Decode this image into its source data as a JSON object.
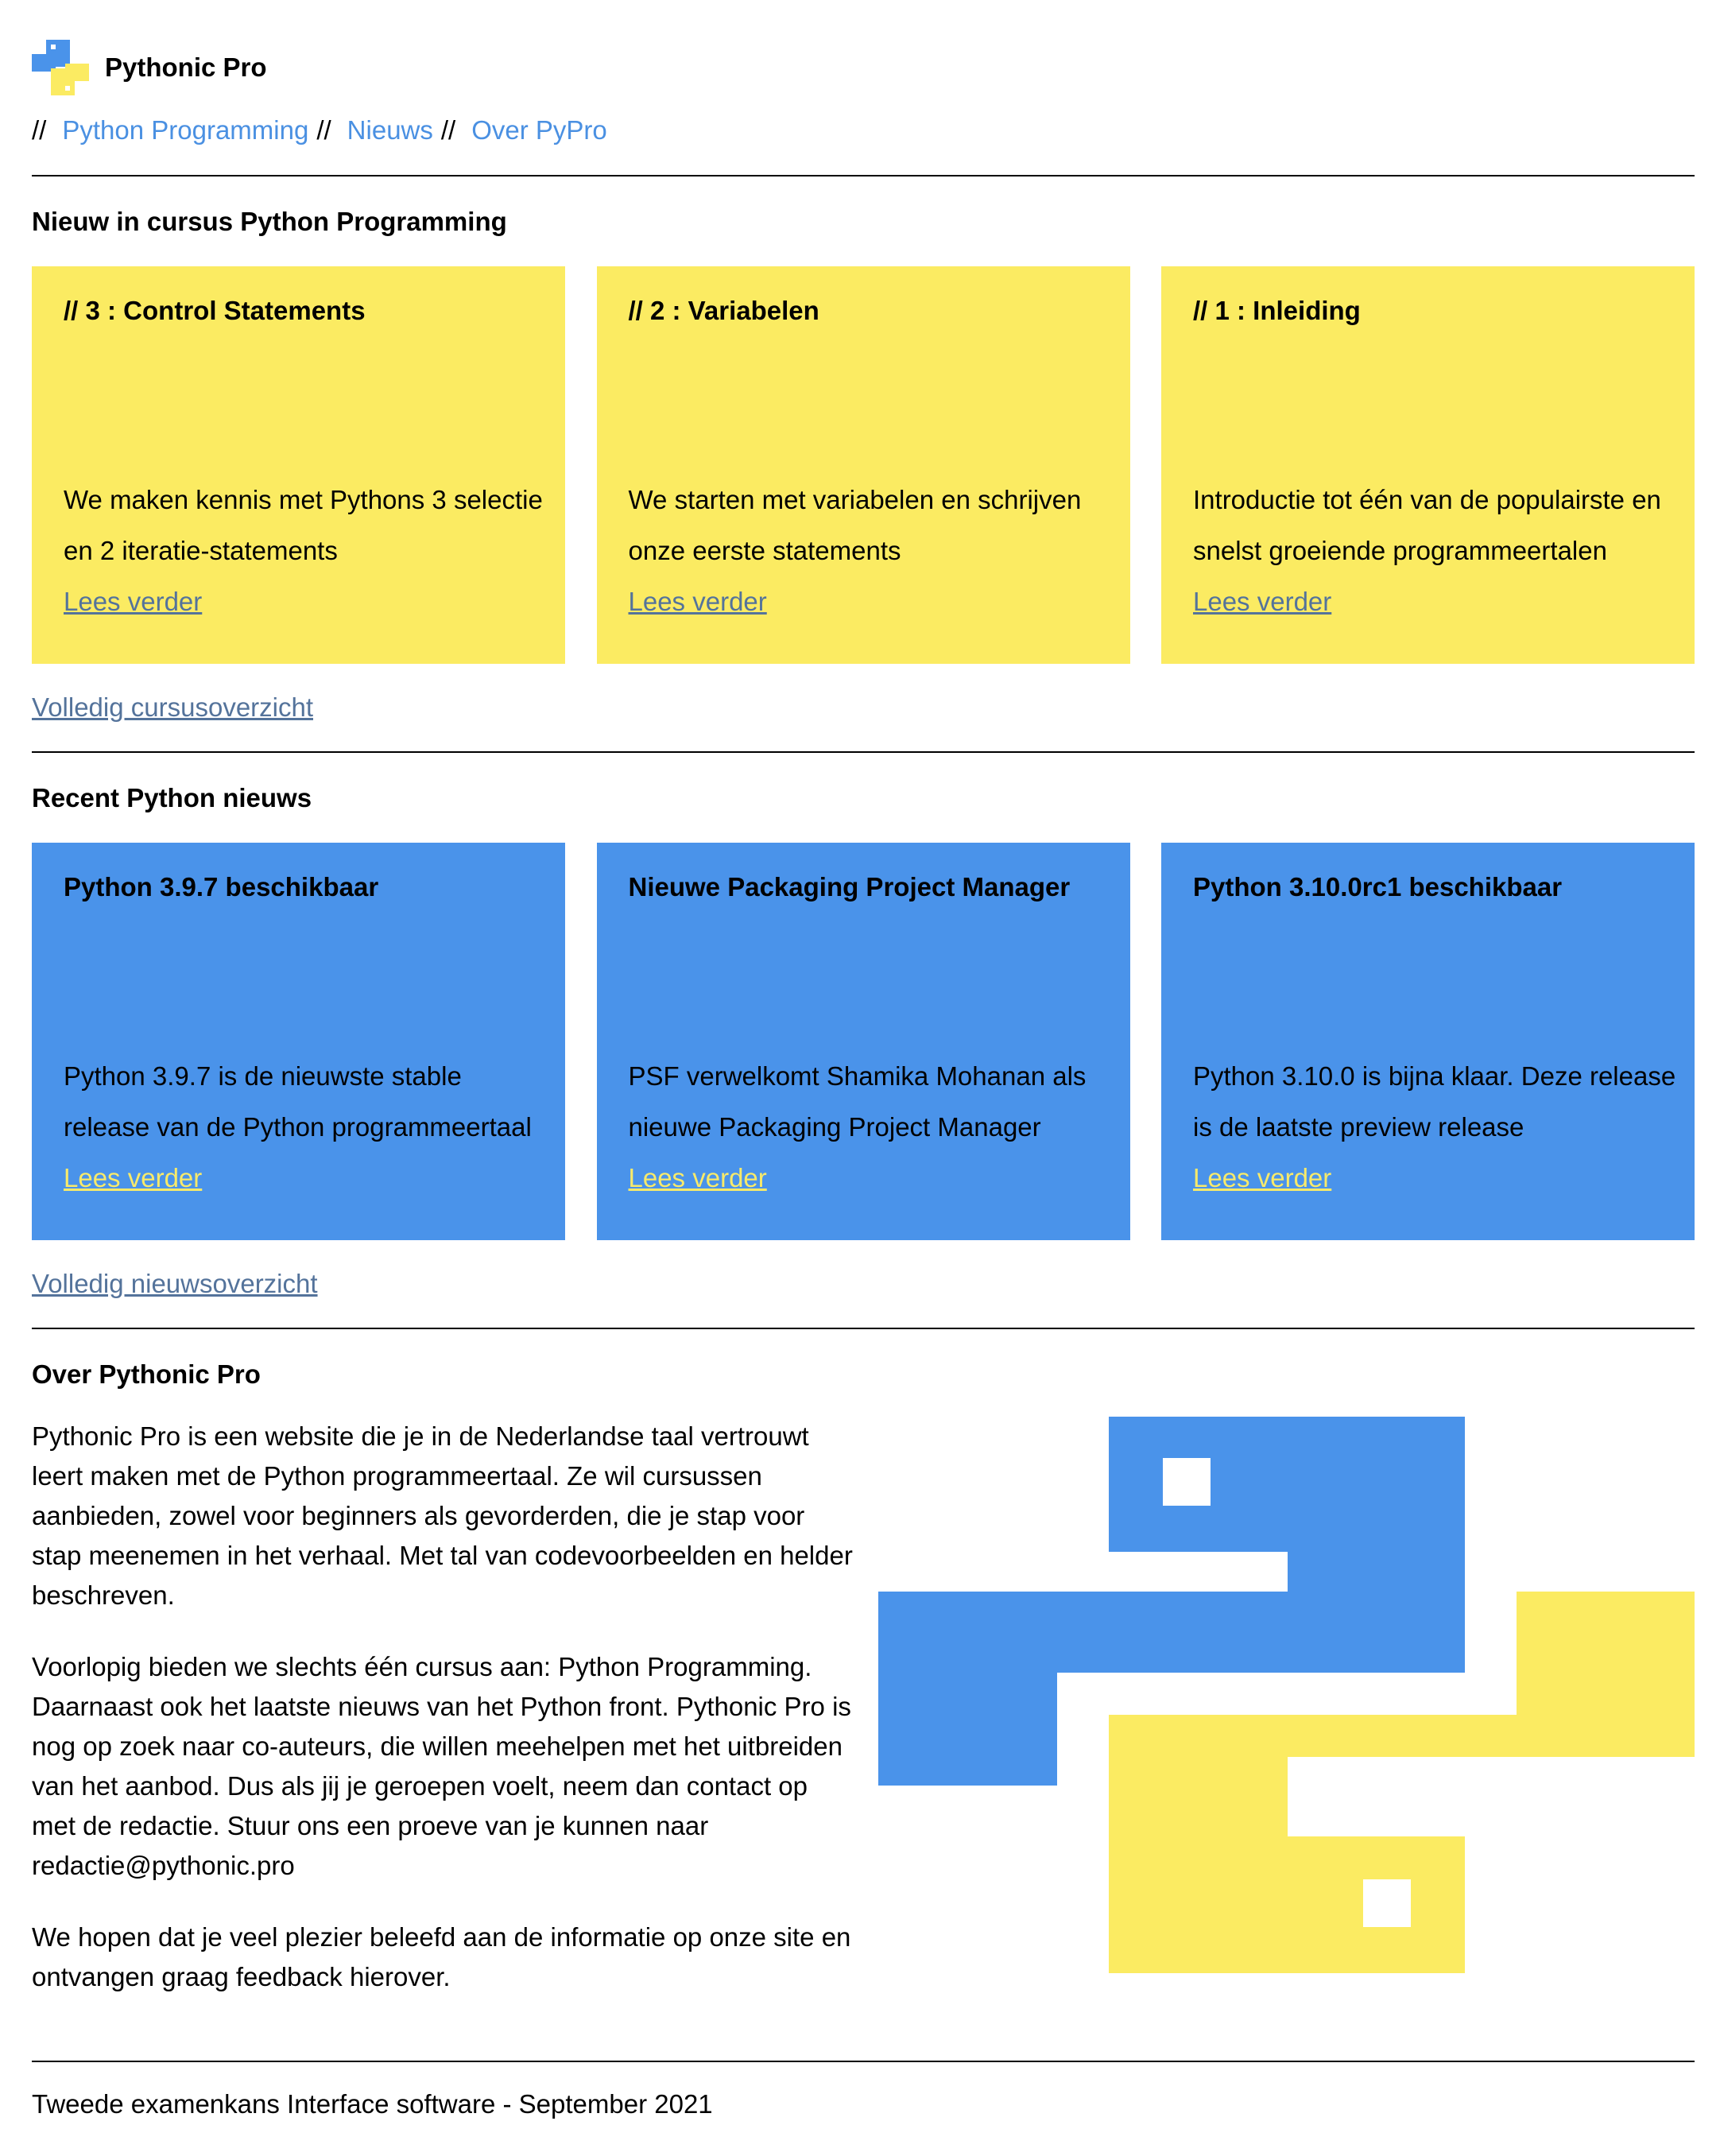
{
  "header": {
    "site_title": "Pythonic Pro",
    "logo_icon": "python-logo-icon"
  },
  "nav": {
    "separator": "//",
    "items": [
      {
        "label": "Python Programming"
      },
      {
        "label": "Nieuws"
      },
      {
        "label": "Over PyPro"
      }
    ]
  },
  "course_section": {
    "title": "Nieuw in cursus Python Programming",
    "cards": [
      {
        "title": "// 3 : Control Statements",
        "text": "We maken kennis met Pythons 3 selectie en 2 iteratie-statements",
        "link": "Lees verder"
      },
      {
        "title": "// 2 : Variabelen",
        "text": "We starten met variabelen en schrijven onze eerste statements",
        "link": "Lees verder"
      },
      {
        "title": "// 1 : Inleiding",
        "text": "Introductie tot één van de populairste en snelst groeiende programmeertalen",
        "link": "Lees verder"
      }
    ],
    "overview_link": "Volledig cursusoverzicht"
  },
  "news_section": {
    "title": "Recent Python nieuws",
    "cards": [
      {
        "title": "Python 3.9.7 beschikbaar",
        "text": "Python 3.9.7 is de nieuwste stable release van de Python programmeertaal",
        "link": "Lees verder"
      },
      {
        "title": "Nieuwe Packaging Project Manager",
        "text": "PSF verwelkomt Shamika Mohanan als nieuwe Packaging Project Manager",
        "link": "Lees verder"
      },
      {
        "title": "Python 3.10.0rc1 beschikbaar",
        "text": "Python 3.10.0 is bijna klaar. Deze release is de laatste preview release",
        "link": "Lees verder"
      }
    ],
    "overview_link": "Volledig nieuwsoverzicht"
  },
  "about_section": {
    "title": "Over Pythonic Pro",
    "paragraphs": [
      "Pythonic Pro is een website die je in de Nederlandse taal vertrouwt leert maken met de Python programmeertaal. Ze wil cursussen aanbieden, zowel voor beginners als gevorderden, die je stap voor stap meenemen in het verhaal. Met tal van codevoorbeelden en helder beschreven.",
      "Voorlopig bieden we slechts één cursus aan: Python Programming. Daarnaast ook het laatste nieuws van het Python front. Pythonic Pro is nog op zoek naar co-auteurs, die willen meehelpen met het uitbreiden van het aanbod. Dus als jij je geroepen voelt, neem dan contact op met de redactie. Stuur ons een proeve van je kunnen naar redactie@pythonic.pro",
      "We hopen dat je veel plezier beleefd aan de informatie op onze site en ontvangen graag feedback hierover."
    ],
    "illustration_icon": "python-logo-illustration"
  },
  "footer": {
    "text": "Tweede examenkans Interface software - September 2021"
  },
  "colors": {
    "yellow": "#fbeb62",
    "blue": "#4a93ea",
    "link_blue": "#4a90e2",
    "link_muted": "#54739b"
  }
}
